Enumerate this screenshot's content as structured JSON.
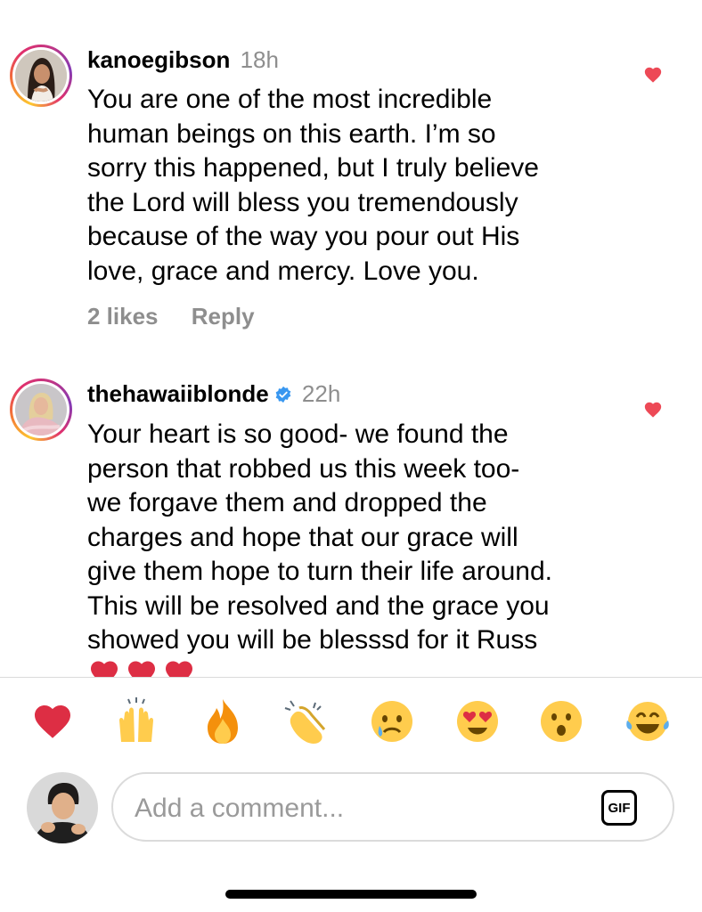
{
  "comments": [
    {
      "username": "kanoegibson",
      "time": "18h",
      "verified": false,
      "text": "You are one of the most incredible\nhuman beings on this earth. I’m so\nsorry this happened, but I truly believe\nthe Lord will bless you tremendously\nbecause of the way you pour out His\nlove, grace and mercy. Love you.",
      "likes_label": "2 likes",
      "reply_label": "Reply",
      "liked": true
    },
    {
      "username": "thehawaiiblonde",
      "time": "22h",
      "verified": true,
      "text": "Your heart is so good- we found the\nperson that robbed us this week too-\nwe forgave them and dropped the\ncharges and hope that our grace will\ngive them hope to turn their life around.\nThis will be resolved and the grace you\nshowed you will be blesssd for it Russ",
      "trailing_emoji": "❤️❤️❤️",
      "liked": true
    }
  ],
  "emoji_bar": [
    "❤️",
    "🙌",
    "🔥",
    "👏",
    "😢",
    "😍",
    "😮",
    "😂"
  ],
  "composer": {
    "placeholder": "Add a comment...",
    "gif_label": "GIF"
  },
  "colors": {
    "like_red": "#ed4956",
    "muted_text": "#8e8e8e",
    "verified_blue": "#3897f0",
    "border": "#dbdbdb"
  },
  "icons": [
    "heart-icon",
    "verified-badge-icon",
    "gif-icon"
  ]
}
